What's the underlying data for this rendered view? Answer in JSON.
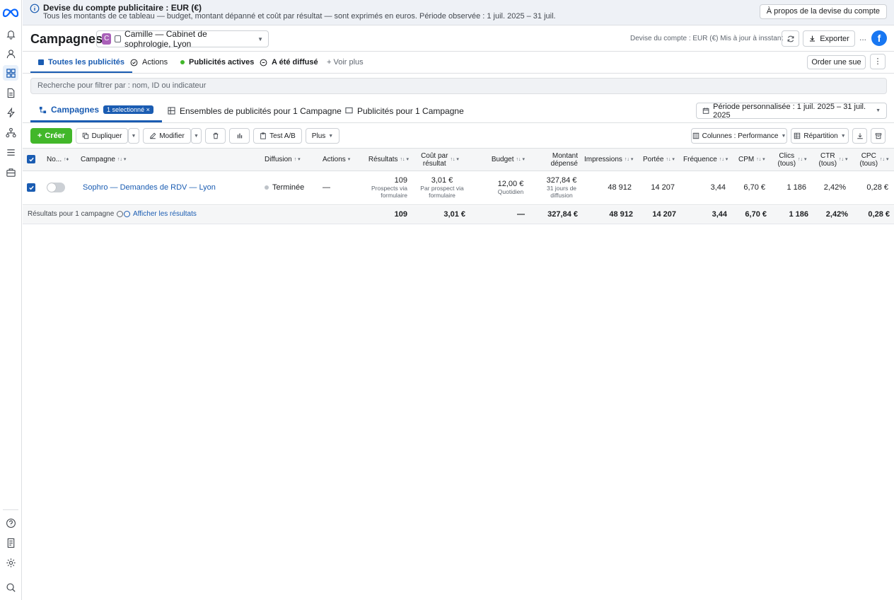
{
  "rail": {
    "icons": [
      "bell-icon",
      "person-icon",
      "grid-icon",
      "document-icon",
      "lightning-icon",
      "network-icon",
      "menu-icon",
      "briefcase-icon"
    ],
    "bottom_icons": [
      "help-icon",
      "report-icon",
      "gear-icon",
      "search-icon"
    ]
  },
  "banner": {
    "title": "Devise du compte publicitaire : EUR (€)",
    "text": "Tous les montants de ce tableau — budget, montant dépanné et coût par résultat — sont exprimés en euros. Période observée : 1 juil. 2025 – 31 juil.",
    "button": "À propos de la devise du compte"
  },
  "header": {
    "title": "Campagnes",
    "account_initial": "C",
    "account_name": "Camille — Cabinet de sophrologie, Lyon",
    "meta": "Devise du compte : EUR (€)  Mis à jour à insstant",
    "export": "Exporter",
    "dots": "...",
    "fb": "f"
  },
  "tabs": {
    "all": "Toutes les publicités",
    "actions": "Actions",
    "active": "Publicités actives",
    "delivered": "A été diffusé",
    "more": "+ Voir plus",
    "order": "Order une sue",
    "kebab": "⋮"
  },
  "search": {
    "placeholder": "Recherche pour filtrer par : nom, ID ou indicateur"
  },
  "levels": {
    "campaigns": "Campagnes",
    "selected_badge": "1 selectionné",
    "adsets": "Ensembles de publicités pour 1 Campagne",
    "ads": "Publicités pour 1 Campagne",
    "period": "Période personnalisée : 1 juil. 2025 – 31 juil. 2025"
  },
  "toolbar": {
    "create": "Créer",
    "duplicate": "Dupliquer",
    "edit": "Modifier",
    "abtest": "Test A/B",
    "more": "Plus",
    "columns": "Colunnes : Performance",
    "breakdown": "Répartition"
  },
  "table": {
    "headers": {
      "name": "No...",
      "campaign": "Campagne",
      "delivery": "Diffusion",
      "actions": "Actions",
      "results": "Résultats",
      "cpr_1": "Coût par",
      "cpr_2": "résultat",
      "budget": "Budget",
      "spent_1": "Montant",
      "spent_2": "dépensé",
      "impressions": "Impressions",
      "reach": "Portée",
      "frequency": "Fréquence",
      "cpm": "CPM",
      "clicks_1": "Clics",
      "clicks_2": "(tous)",
      "ctr_1": "CTR",
      "ctr_2": "(tous)",
      "cpc_1": "CPC",
      "cpc_2": "(tous)"
    },
    "row": {
      "campaign": "Sophro — Demandes de RDV — Lyon",
      "delivery": "Terminée",
      "actions": "—",
      "results": "109",
      "results_sub_1": "Prospects via",
      "results_sub_2": "formulaire",
      "cpr": "3,01 €",
      "cpr_sub_1": "Par prospect via",
      "cpr_sub_2": "formulaire",
      "budget": "12,00 €",
      "budget_sub": "Quotidien",
      "spent": "327,84 €",
      "spent_sub_1": "31 jours de",
      "spent_sub_2": "diffusion",
      "impressions": "48 912",
      "reach": "14 207",
      "frequency": "3,44",
      "cpm": "6,70 €",
      "clicks": "1 186",
      "ctr": "2,42%",
      "cpc": "0,28 €"
    },
    "total": {
      "label": "Résultats pour 1 campagne",
      "show": "Afficher les résultats",
      "results": "109",
      "cpr": "3,01 €",
      "budget": "—",
      "spent": "327,84 €",
      "impressions": "48 912",
      "reach": "14 207",
      "frequency": "3,44",
      "cpm": "6,70 €",
      "clicks": "1 186",
      "ctr": "2,42%",
      "cpc": "0,28 €"
    }
  },
  "colors": {
    "accent": "#1a5cb2",
    "create": "#42b72a",
    "facebook": "#1877f2"
  }
}
